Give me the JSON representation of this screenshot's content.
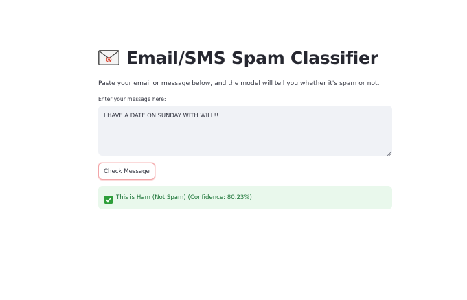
{
  "header": {
    "icon": "envelope-with-at-icon",
    "title": "Email/SMS Spam Classifier",
    "subtitle": "Paste your email or message below, and the model will tell you whether it's spam or not."
  },
  "form": {
    "label": "Enter your message here:",
    "message_value": "I HAVE A DATE ON SUNDAY WITH WILL!!",
    "button_label": "Check Message"
  },
  "result": {
    "icon": "white-check-mark-icon",
    "text": "This is Ham (Not Spam) (Confidence: 80.23%)",
    "status_color": "#177233",
    "background_color": "#e9f8ec"
  },
  "colors": {
    "button_focus_border": "#f2a5a8",
    "input_background": "#f0f2f6",
    "check_green": "#2e9e3a"
  }
}
